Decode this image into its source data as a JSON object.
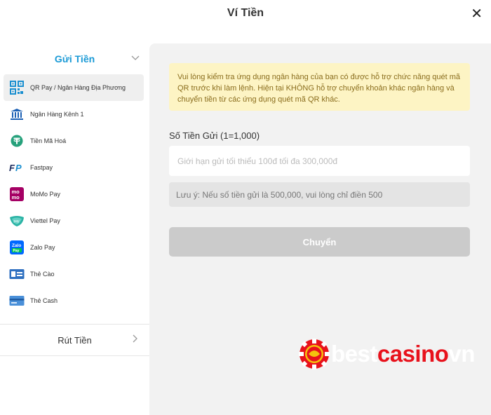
{
  "header": {
    "title": "Ví Tiền",
    "close_glyph": "✕"
  },
  "sidebar": {
    "deposit_label": "Gửi Tiền",
    "withdraw_label": "Rút Tiền",
    "items": [
      {
        "label": "QR Pay / Ngân Hàng Địa Phương",
        "icon": "qr-code-icon"
      },
      {
        "label": "Ngân Hàng Kênh 1",
        "icon": "bank-icon"
      },
      {
        "label": "Tiền Mã Hoá",
        "icon": "tether-icon"
      },
      {
        "label": "Fastpay",
        "icon": "fastpay-icon"
      },
      {
        "label": "MoMo Pay",
        "icon": "momo-icon"
      },
      {
        "label": "Viettel Pay",
        "icon": "viettel-icon"
      },
      {
        "label": "Zalo Pay",
        "icon": "zalo-icon"
      },
      {
        "label": "Thẻ Cào",
        "icon": "scratch-card-icon"
      },
      {
        "label": "Thẻ Cash",
        "icon": "cash-card-icon"
      }
    ]
  },
  "form": {
    "notice": "Vui lòng kiểm tra ứng dụng ngân hàng của bạn có được hỗ trợ chức năng quét mã QR trước khi làm lệnh. Hiện tại KHÔNG hỗ trợ chuyển khoản khác ngân hàng và chuyển tiền từ các ứng dụng quét mã QR khác.",
    "amount_label": "Số Tiền Gửi (1=1,000)",
    "amount_placeholder": "Giới hạn gửi tối thiểu 100đ tối đa 300,000đ",
    "amount_value": "",
    "note": "Lưu ý: Nếu số tiền gửi là 500,000, vui lòng chỉ điền 500",
    "submit_label": "Chuyển"
  },
  "watermark": {
    "part1": "best",
    "part2": "casino",
    "part3": "vn"
  },
  "colors": {
    "accent": "#1a9ad6",
    "notice_bg": "#fdf4c4",
    "button_disabled": "#cbcbcb"
  }
}
